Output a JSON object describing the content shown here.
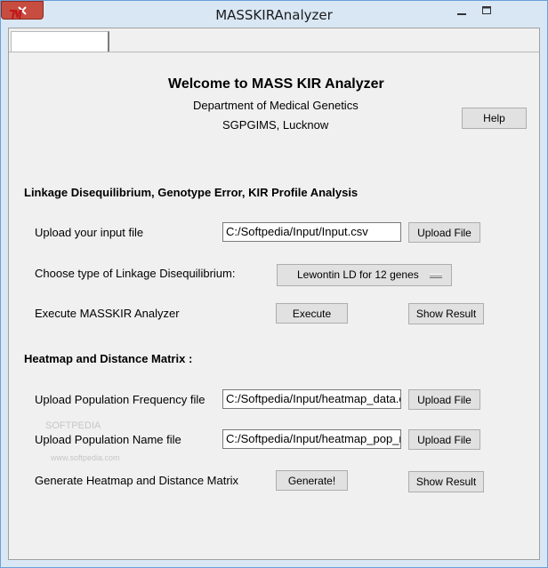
{
  "window": {
    "title": "MASSKIRAnalyzer"
  },
  "header": {
    "welcome": "Welcome to MASS KIR Analyzer",
    "department": "Department of Medical Genetics",
    "institute": "SGPGIMS, Lucknow",
    "help_label": "Help"
  },
  "ld_section": {
    "title": "Linkage Disequilibrium, Genotype Error, KIR Profile Analysis",
    "upload_label": "Upload your input file",
    "input_path": "C:/Softpedia/Input/Input.csv",
    "upload_button": "Upload File",
    "choose_label": "Choose type of Linkage Disequilibrium:",
    "ld_selected": "Lewontin LD for 12 genes",
    "execute_label": "Execute MASSKIR Analyzer",
    "execute_button": "Execute",
    "show_result_button": "Show Result"
  },
  "heatmap_section": {
    "title": "Heatmap and Distance Matrix :",
    "freq_label": "Upload Population Frequency file",
    "freq_path": "C:/Softpedia/Input/heatmap_data.csv",
    "freq_upload_button": "Upload File",
    "name_label": "Upload Population Name file",
    "name_path": "C:/Softpedia/Input/heatmap_pop_names.csv",
    "name_upload_button": "Upload File",
    "generate_label": "Generate Heatmap and Distance Matrix",
    "generate_button": "Generate!",
    "show_result_button": "Show Result"
  },
  "watermark": {
    "text": "SOFTPEDIA",
    "url": "www.softpedia.com"
  },
  "colors": {
    "titlebar": "#d9e7f5",
    "close_button": "#c74d40",
    "panel": "#f0f0f0",
    "button": "#e1e1e1"
  }
}
